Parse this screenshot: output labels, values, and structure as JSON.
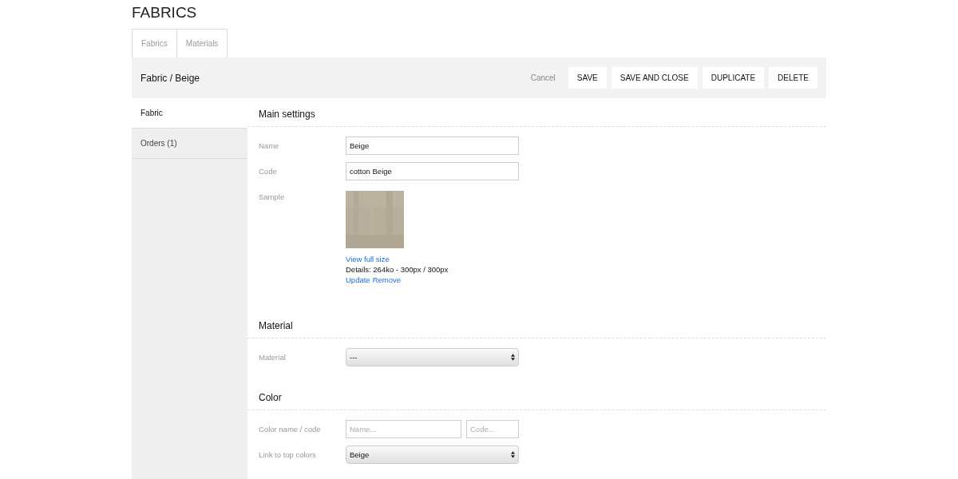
{
  "page_title": "FABRICS",
  "tabs": [
    {
      "label": "Fabrics"
    },
    {
      "label": "Materials"
    }
  ],
  "header": {
    "breadcrumb": "Fabric / Beige",
    "cancel": "Cancel",
    "buttons": [
      "SAVE",
      "SAVE AND CLOSE",
      "DUPLICATE",
      "DELETE"
    ]
  },
  "sidebar": {
    "items": [
      {
        "label": "Fabric",
        "selected": true
      },
      {
        "label": "Orders (1)",
        "selected": false
      }
    ]
  },
  "sections": [
    {
      "title": "Main settings",
      "fields": [
        {
          "kind": "text",
          "label": "Name",
          "value": "Beige"
        },
        {
          "kind": "text",
          "label": "Code",
          "value": "cotton Beige"
        },
        {
          "label": "Sample",
          "view_link": "View full size",
          "details": "Details: 264ko - 300px / 300px",
          "update_link": "Update",
          "remove_link": "Remove"
        }
      ]
    },
    {
      "title": "Material",
      "fields": [
        {
          "kind": "select",
          "label": "Material",
          "value": "---"
        }
      ]
    },
    {
      "title": "Color",
      "fields": [
        {
          "kind": "pair",
          "label": "Color name / code",
          "placeholder": "Name...",
          "placeholder_2": "Code..."
        },
        {
          "kind": "select",
          "label": "Link to top colors",
          "value": "Beige"
        }
      ]
    }
  ]
}
